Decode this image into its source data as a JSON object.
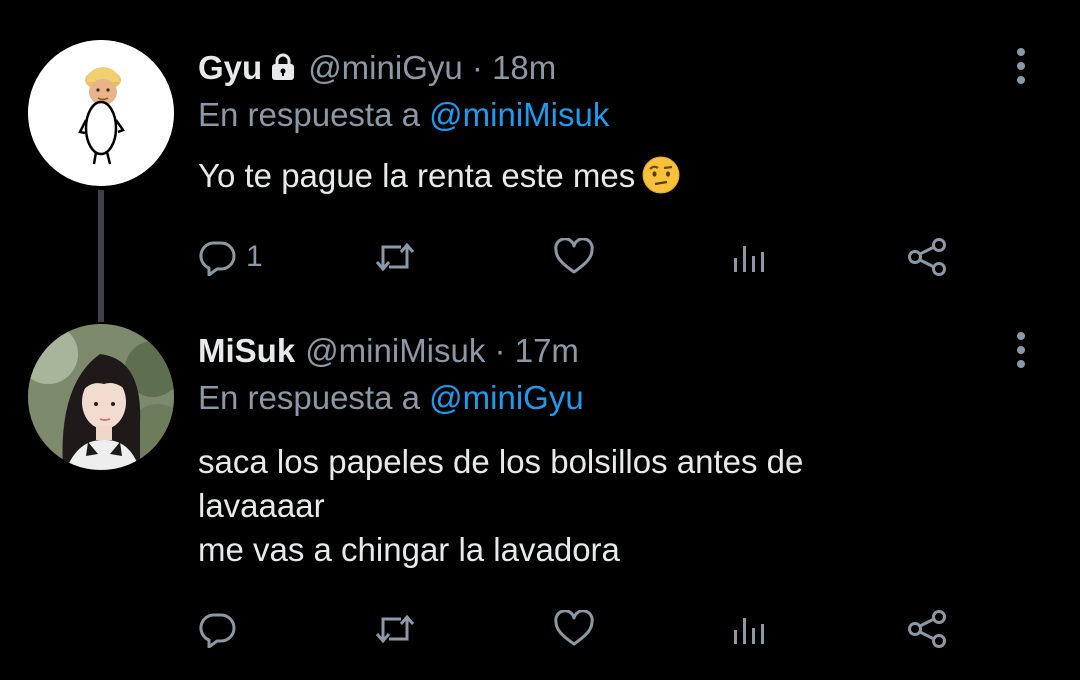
{
  "colors": {
    "background": "#000000",
    "text_primary": "#e7e9ea",
    "text_secondary": "#8b98a5",
    "mention": "#1d9bf0",
    "thread_line": "#3d4145"
  },
  "tweets": [
    {
      "display_name": "Gyu",
      "protected_icon": "lock-icon",
      "handle": "@miniGyu",
      "separator": "·",
      "time": "18m",
      "reply_prefix": "En respuesta a",
      "reply_to": "@miniMisuk",
      "text_lines": [
        "Yo te pague la renta este mes"
      ],
      "emoji": "face-with-raised-eyebrow",
      "actions": {
        "reply_count": "1",
        "retweet_count": "",
        "like_count": ""
      }
    },
    {
      "display_name": "MiSuk",
      "handle": "@miniMisuk",
      "separator": "·",
      "time": "17m",
      "reply_prefix": "En respuesta a",
      "reply_to": "@miniGyu",
      "text_lines": [
        "saca los papeles de los bolsillos antes de",
        "lavaaaar",
        "me vas a chingar la lavadora"
      ],
      "actions": {
        "reply_count": "",
        "retweet_count": "",
        "like_count": ""
      }
    }
  ]
}
